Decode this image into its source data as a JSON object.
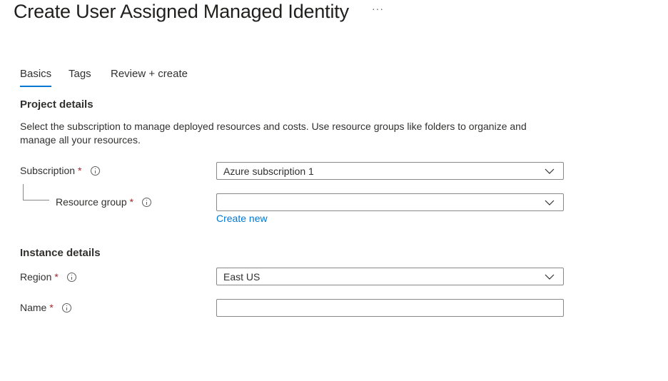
{
  "header": {
    "title": "Create User Assigned Managed Identity",
    "more_label": "···"
  },
  "tabs": [
    {
      "label": "Basics",
      "active": true
    },
    {
      "label": "Tags",
      "active": false
    },
    {
      "label": "Review + create",
      "active": false
    }
  ],
  "project_details": {
    "title": "Project details",
    "description": "Select the subscription to manage deployed resources and costs. Use resource groups like folders to organize and manage all your resources.",
    "subscription": {
      "label": "Subscription",
      "required": "*",
      "value": "Azure subscription 1"
    },
    "resource_group": {
      "label": "Resource group",
      "required": "*",
      "value": "",
      "create_new_label": "Create new"
    }
  },
  "instance_details": {
    "title": "Instance details",
    "region": {
      "label": "Region",
      "required": "*",
      "value": "East US"
    },
    "name": {
      "label": "Name",
      "required": "*",
      "value": ""
    }
  },
  "icons": {
    "info": "info-icon",
    "dropdown": "chevron-down-icon",
    "more": "more-icon"
  },
  "colors": {
    "accent": "#0078d4",
    "required": "#a4262c",
    "border": "#8a8886"
  }
}
